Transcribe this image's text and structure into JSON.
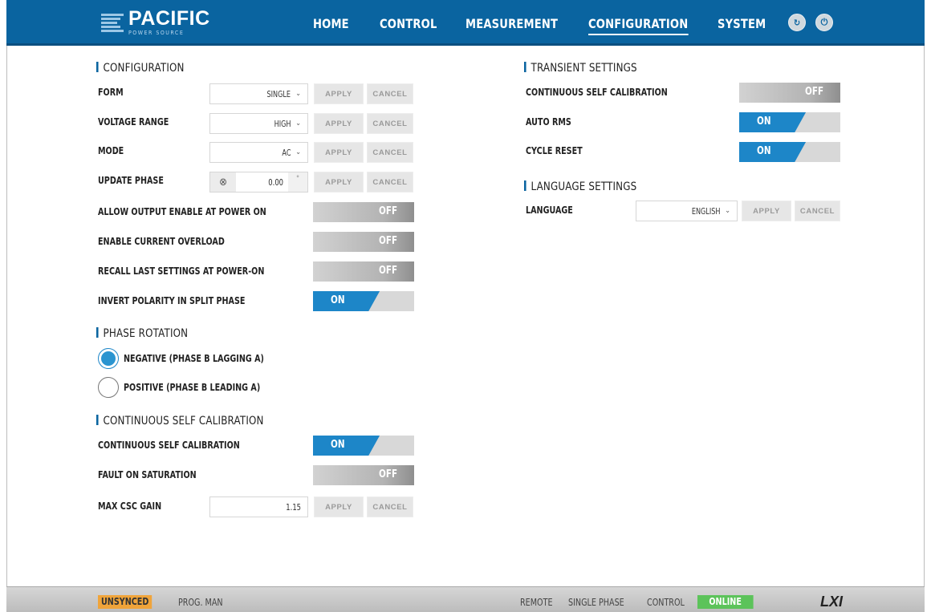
{
  "header": {
    "brand": "PACIFIC",
    "brand_sub": "POWER SOURCE",
    "nav": [
      "HOME",
      "CONTROL",
      "MEASUREMENT",
      "CONFIGURATION",
      "SYSTEM"
    ],
    "active_nav": "CONFIGURATION",
    "refresh_icon": "refresh-icon",
    "power_icon": "power-icon"
  },
  "config": {
    "title": "CONFIGURATION",
    "form": {
      "label": "FORM",
      "value": "SINGLE"
    },
    "voltage_range": {
      "label": "VOLTAGE RANGE",
      "value": "HIGH"
    },
    "mode": {
      "label": "MODE",
      "value": "AC"
    },
    "update_phase": {
      "label": "UPDATE PHASE",
      "value": "0.00",
      "unit": "°"
    },
    "apply": "APPLY",
    "cancel": "CANCEL",
    "allow_output": {
      "label": "ALLOW OUTPUT ENABLE AT POWER ON",
      "state": "OFF"
    },
    "enable_current_overload": {
      "label": "ENABLE CURRENT OVERLOAD",
      "state": "OFF"
    },
    "recall_last": {
      "label": "RECALL LAST SETTINGS AT POWER-ON",
      "state": "OFF"
    },
    "invert_polarity": {
      "label": "INVERT POLARITY IN SPLIT PHASE",
      "state": "ON"
    }
  },
  "phase_rotation": {
    "title": "PHASE ROTATION",
    "negative": "NEGATIVE (PHASE B LAGGING A)",
    "positive": "POSITIVE (PHASE B LEADING A)",
    "selected": "negative"
  },
  "csc": {
    "title": "CONTINUOUS SELF CALIBRATION",
    "csc_toggle": {
      "label": "CONTINUOUS SELF CALIBRATION",
      "state": "ON"
    },
    "fault_saturation": {
      "label": "FAULT ON SATURATION",
      "state": "OFF"
    },
    "max_gain": {
      "label": "MAX CSC GAIN",
      "value": "1.15"
    }
  },
  "transient": {
    "title": "TRANSIENT SETTINGS",
    "csc": {
      "label": "CONTINUOUS SELF CALIBRATION",
      "state": "OFF"
    },
    "auto_rms": {
      "label": "AUTO RMS",
      "state": "ON"
    },
    "cycle_reset": {
      "label": "CYCLE RESET",
      "state": "ON"
    }
  },
  "language": {
    "title": "LANGUAGE SETTINGS",
    "label": "LANGUAGE",
    "value": "ENGLISH"
  },
  "status": {
    "sync": "UNSYNCED",
    "prog": "PROG. MAN",
    "remote": "REMOTE",
    "phase": "SINGLE PHASE",
    "control": "CONTROL",
    "online": "ONLINE",
    "logo": "LXI"
  },
  "colors": {
    "accent": "#0a64a0",
    "toggle_on": "#1d86c8",
    "online": "#5cc35a",
    "unsynced": "#f0a43a"
  }
}
